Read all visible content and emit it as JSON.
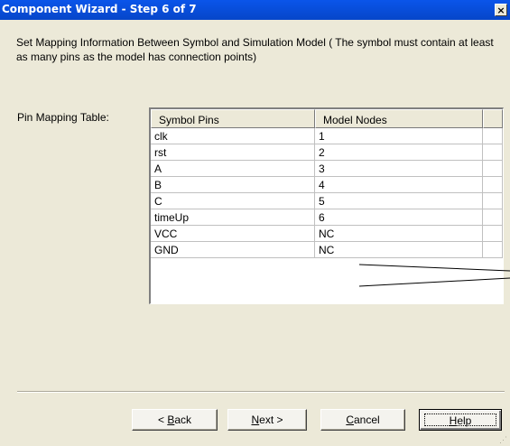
{
  "window": {
    "title": "Component Wizard - Step 6 of 7",
    "close_glyph": "×",
    "close_icon": "close-icon"
  },
  "description": "Set Mapping Information Between Symbol and Simulation Model ( The symbol must contain at least as many pins as the model has connection points)",
  "pin_mapping": {
    "label": "Pin Mapping Table:",
    "columns": [
      "Symbol Pins",
      "Model Nodes",
      ""
    ],
    "rows": [
      [
        "clk",
        "1"
      ],
      [
        "rst",
        "2"
      ],
      [
        "A",
        "3"
      ],
      [
        "B",
        "4"
      ],
      [
        "C",
        "5"
      ],
      [
        "timeUp",
        "6"
      ],
      [
        "VCC",
        "NC"
      ],
      [
        "GND",
        "NC"
      ]
    ]
  },
  "buttons": {
    "back": {
      "prefix": "< ",
      "accel": "B",
      "rest": "ack"
    },
    "next": {
      "prefix": "",
      "accel": "N",
      "rest": "ext >"
    },
    "cancel": {
      "prefix": "",
      "accel": "C",
      "rest": "ancel"
    },
    "help": {
      "prefix": "",
      "accel": "H",
      "rest": "elp"
    }
  }
}
